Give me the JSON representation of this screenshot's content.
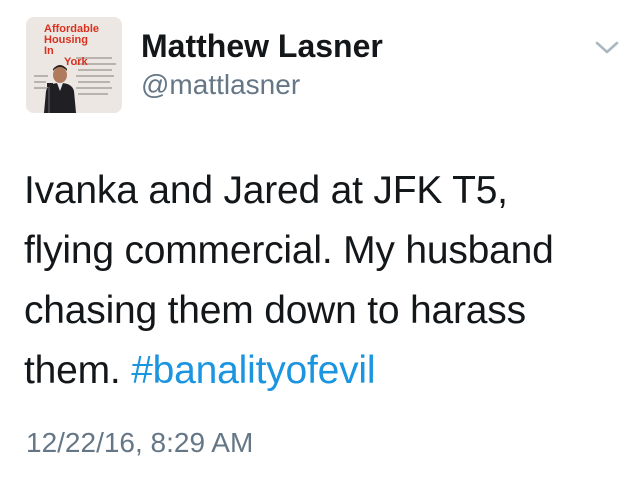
{
  "user": {
    "display_name": "Matthew Lasner",
    "handle": "@mattlasner",
    "avatar": {
      "icon": "profile-photo",
      "poster_title_lines": [
        "Affordable",
        "Housing",
        "In",
        "New York"
      ]
    }
  },
  "menu": {
    "icon": "chevron-down-icon"
  },
  "tweet": {
    "text_lines": [
      "Ivanka and Jared at JFK T5,",
      "flying commercial. My husband",
      "chasing them down to harass",
      "them."
    ],
    "hashtag": "#banalityofevil",
    "timestamp": "12/22/16, 8:29 AM"
  },
  "colors": {
    "hashtag": "#1b95e0",
    "secondary_text": "#657786",
    "primary_text": "#14171a"
  }
}
